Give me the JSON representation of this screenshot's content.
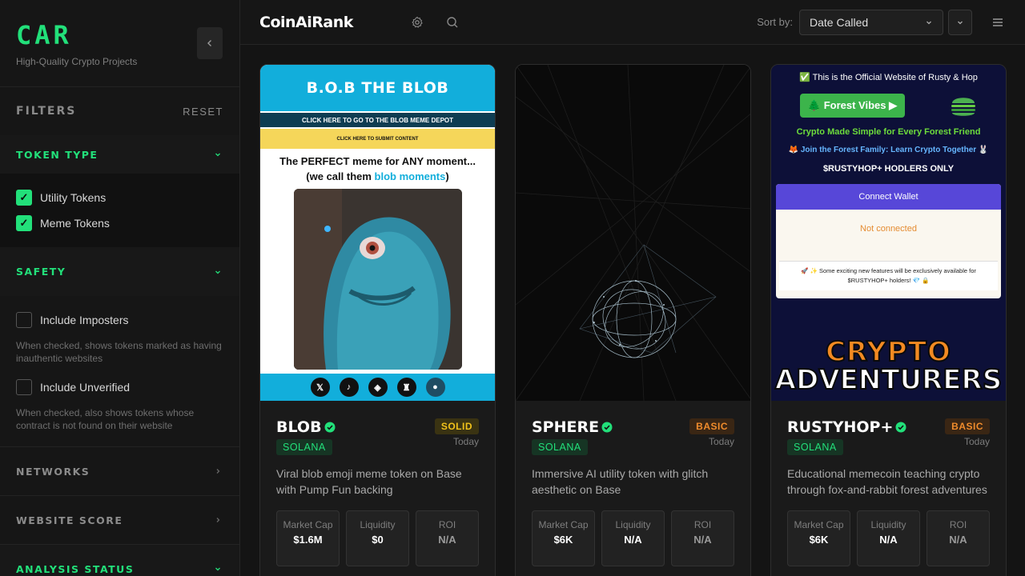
{
  "sidebar": {
    "brand": "CAR",
    "tagline": "High-Quality Crypto Projects",
    "filters_title": "FILTERS",
    "reset_label": "RESET",
    "sections": {
      "token_type": {
        "title": "TOKEN TYPE",
        "options": [
          {
            "label": "Utility Tokens",
            "checked": true
          },
          {
            "label": "Meme Tokens",
            "checked": true
          }
        ]
      },
      "safety": {
        "title": "SAFETY",
        "imposters_label": "Include Imposters",
        "imposters_help": "When checked, shows tokens marked as having inauthentic websites",
        "unverified_label": "Include Unverified",
        "unverified_help": "When checked, also shows tokens whose contract is not found on their website"
      },
      "networks": {
        "title": "NETWORKS"
      },
      "website_score": {
        "title": "WEBSITE SCORE"
      },
      "analysis_status": {
        "title": "ANALYSIS STATUS"
      }
    }
  },
  "topbar": {
    "title": "CoinAiRank",
    "sort_label": "Sort by:",
    "sort_value": "Date Called"
  },
  "cards": [
    {
      "name": "BLOB",
      "tier": "SOLID",
      "chain": "SOLANA",
      "time": "Today",
      "description": "Viral blob emoji meme token on Base with Pump Fun backing",
      "stats": {
        "market_cap_label": "Market Cap",
        "market_cap": "$1.6M",
        "liquidity_label": "Liquidity",
        "liquidity": "$0",
        "roi_label": "ROI",
        "roi": "N/A"
      },
      "art": {
        "title": "B.O.B THE BLOB",
        "link1": "CLICK HERE TO GO TO THE BLOB MEME DEPOT",
        "link2": "CLICK HERE TO SUBMIT CONTENT",
        "headline": "The PERFECT meme for ANY moment...",
        "sub_prefix": "(we call them ",
        "sub_em": "blob moments",
        "sub_suffix": ")"
      }
    },
    {
      "name": "SPHERE",
      "tier": "BASIC",
      "chain": "SOLANA",
      "time": "Today",
      "description": "Immersive AI utility token with glitch aesthetic on Base",
      "stats": {
        "market_cap_label": "Market Cap",
        "market_cap": "$6K",
        "liquidity_label": "Liquidity",
        "liquidity": "N/A",
        "roi_label": "ROI",
        "roi": "N/A"
      }
    },
    {
      "name": "RUSTYHOP+",
      "tier": "BASIC",
      "chain": "SOLANA",
      "time": "Today",
      "description": "Educational memecoin teaching crypto through fox-and-rabbit forest adventures",
      "stats": {
        "market_cap_label": "Market Cap",
        "market_cap": "$6K",
        "liquidity_label": "Liquidity",
        "liquidity": "N/A",
        "roi_label": "ROI",
        "roi": "N/A"
      },
      "art": {
        "official": "✅ This is the Official Website of Rusty & Hop",
        "forest_btn": "🌲 Forest Vibes ▶",
        "tagline": "Crypto Made Simple for Every Forest Friend",
        "join": "🦊 Join the Forest Family: Learn Crypto Together 🐰",
        "holders": "$RUSTYHOP+ HODLERS ONLY",
        "connect": "Connect Wallet",
        "status": "Not connected",
        "note": "🚀 ✨ Some exciting new features will be exclusively available for $RUSTYHOP+ holders! 💎 🔒",
        "adv1": "CRYPTO",
        "adv2": "ADVENTURERS"
      }
    }
  ],
  "colors": {
    "accent": "#22e07a",
    "solid_badge": "#f1c21b",
    "basic_badge": "#f08c2c"
  }
}
